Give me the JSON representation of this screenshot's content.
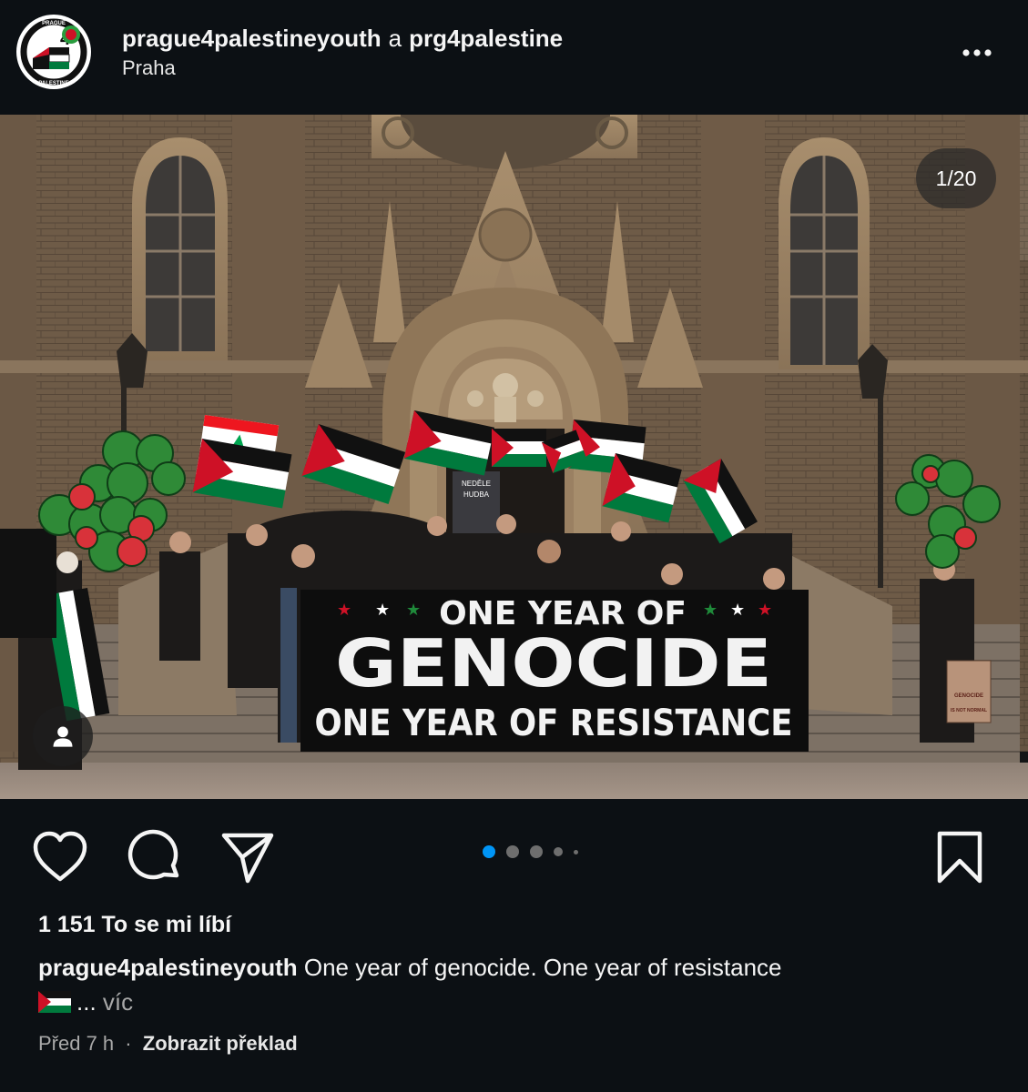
{
  "header": {
    "user_primary": "prague4palestineyouth",
    "separator": "a",
    "user_secondary": "prg4palestine",
    "location": "Praha",
    "avatar_logo_text": [
      "PRAGUE",
      "4",
      "PALESTINE"
    ]
  },
  "media": {
    "counter": "1/20",
    "slide_index": 1,
    "slide_total": 20,
    "banner": {
      "line1": "ONE YEAR OF",
      "line2": "GENOCIDE",
      "line3": "ONE YEAR OF RESISTANCE"
    },
    "poster_text": [
      "NEDĚLE",
      "HUDBA"
    ],
    "sign_text": [
      "GENOCIDE",
      "IS NOT NORMAL"
    ],
    "tag_icon": "person-icon"
  },
  "actions": {
    "like_icon": "heart-icon",
    "comment_icon": "comment-bubble-icon",
    "share_icon": "paper-plane-icon",
    "save_icon": "bookmark-icon",
    "pagination_dots": 5,
    "active_dot": 0
  },
  "engagement": {
    "likes": "1 151 To se mi líbí"
  },
  "caption": {
    "user": "prague4palestineyouth",
    "text": "One year of genocide. One year of resistance",
    "ellipsis": "...",
    "more": "víc",
    "emoji": "palestine-flag-emoji"
  },
  "meta": {
    "time": "Před 7 h",
    "separator": "·",
    "translate": "Zobrazit překlad"
  },
  "colors": {
    "background": "#0c1014",
    "text": "#f5f5f5",
    "muted": "#a8a8a8",
    "active_dot": "#0095f6",
    "palestine_red": "#ce1126",
    "palestine_green": "#007a3d"
  }
}
